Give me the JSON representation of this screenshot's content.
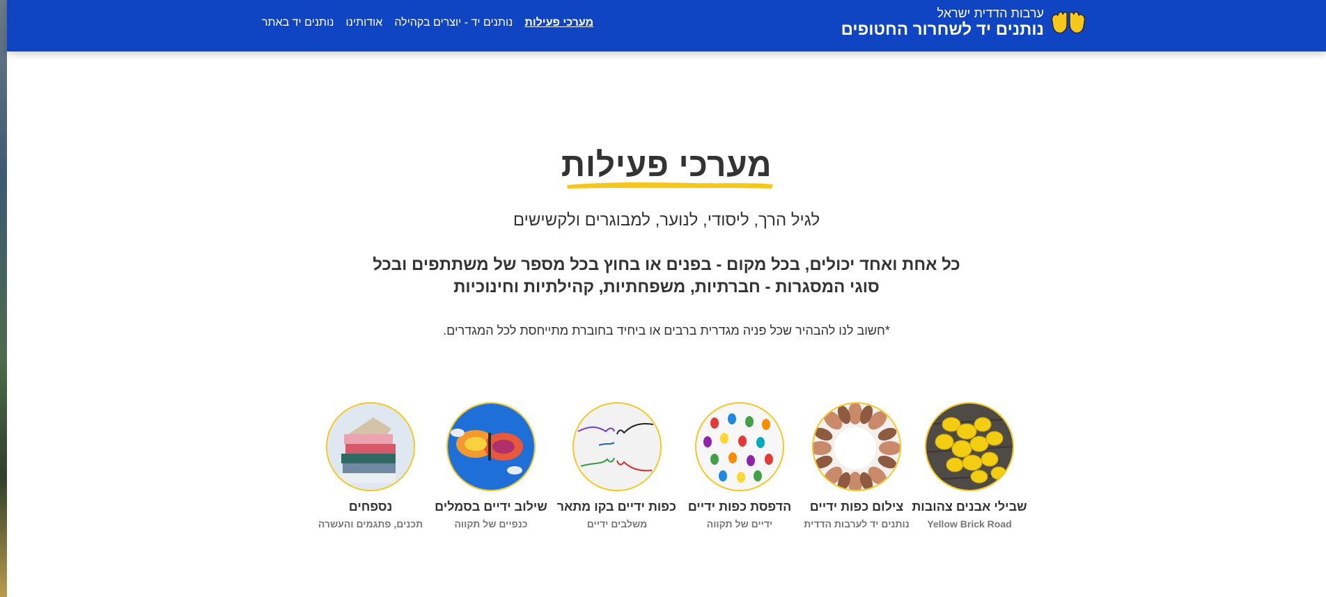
{
  "header": {
    "brand_small": "ערבות הדדית ישראל",
    "brand_big": "נותנים יד לשחרור החטופים",
    "logo_icon": "yellow-hands-icon",
    "nav": [
      {
        "label": "מערכי פעילות",
        "active": true
      },
      {
        "label": "נותנים יד - יוצרים בקהילה",
        "active": false
      },
      {
        "label": "אודותינו",
        "active": false
      },
      {
        "label": "נותנים יד באתר",
        "active": false
      }
    ]
  },
  "main": {
    "title": "מערכי פעילות",
    "subtitle": "לגיל הרך, ליסודי, לנוער, למבוגרים ולקשישים",
    "lead": "כל אחת ואחד יכולים, בכל מקום - בפנים או בחוץ בכל מספר של משתתפים ובכל סוגי המסגרות - חברתיות, משפחתיות, קהילתיות וחינוכיות",
    "note": "*חשוב לנו להבהיר שכל פניה מגדרית ברבים או ביחיד בחוברת מתייחסת לכל המגדרים."
  },
  "activities": [
    {
      "title": "שבילי אבנים צהובות",
      "subtitle": "Yellow Brick Road",
      "image": "yellow-stones-image"
    },
    {
      "title": "צילום כפות ידיים",
      "subtitle": "נותנים יד לערבות הדדית",
      "image": "hands-circle-image"
    },
    {
      "title": "הדפסת כפות ידיים",
      "subtitle": "ידיים של תקווה",
      "image": "colorful-handprints-image"
    },
    {
      "title": "כפות ידיים בקו מתאר",
      "subtitle": "משלבים ידיים",
      "image": "outline-hands-image"
    },
    {
      "title": "שילוב ידיים בסמלים",
      "subtitle": "כנפיים של תקווה",
      "image": "butterfly-hands-image"
    },
    {
      "title": "נספחים",
      "subtitle": "תכנים, פתגמים והעשרה",
      "image": "books-stack-image"
    }
  ],
  "colors": {
    "header_bg": "#0f45c2",
    "accent_yellow": "#f6c619",
    "text": "#333333"
  }
}
